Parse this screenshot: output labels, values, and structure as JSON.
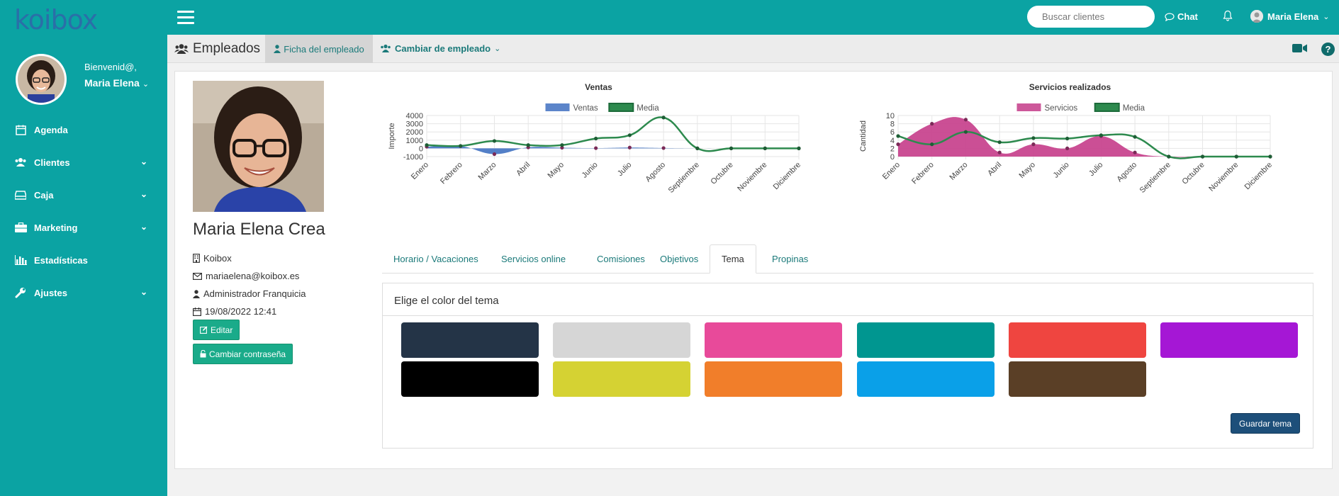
{
  "app": {
    "logo": "koibox"
  },
  "sidebar": {
    "welcome": "Bienvenid@,",
    "user_name": "Maria Elena",
    "items": [
      {
        "label": "Agenda",
        "icon": "calendar-icon",
        "has_submenu": false
      },
      {
        "label": "Clientes",
        "icon": "users-icon",
        "has_submenu": true
      },
      {
        "label": "Caja",
        "icon": "cash-drawer-icon",
        "has_submenu": true
      },
      {
        "label": "Marketing",
        "icon": "briefcase-icon",
        "has_submenu": true
      },
      {
        "label": "Estadísticas",
        "icon": "bar-chart-icon",
        "has_submenu": false
      },
      {
        "label": "Ajustes",
        "icon": "wrench-icon",
        "has_submenu": true
      }
    ]
  },
  "topbar": {
    "search_placeholder": "Buscar clientes",
    "chat_label": "Chat",
    "user_name": "Maria Elena"
  },
  "subbar": {
    "title": "Empleados",
    "active_tab": "Ficha del empleado",
    "change_label": "Cambiar de empleado"
  },
  "employee": {
    "name": "Maria Elena Crea",
    "company": "Koibox",
    "email": "mariaelena@koibox.es",
    "role": "Administrador Franquicia",
    "date": "19/08/2022 12:41",
    "edit_label": "Editar",
    "change_password_label": "Cambiar contraseña"
  },
  "chart_data": [
    {
      "type": "area",
      "title": "Ventas",
      "ylabel": "Importe",
      "categories": [
        "Enero",
        "Febrero",
        "Marzo",
        "Abril",
        "Mayo",
        "Junio",
        "Julio",
        "Agosto",
        "Septiembre",
        "Octubre",
        "Noviembre",
        "Diciembre"
      ],
      "ylim": [
        -1000,
        4000
      ],
      "yticks": [
        4000,
        3000,
        2000,
        1000,
        0,
        -1000
      ],
      "series": [
        {
          "name": "Ventas",
          "color": "#4a78c4",
          "fill": true,
          "values": [
            200,
            280,
            -700,
            120,
            80,
            30,
            100,
            40,
            0,
            0,
            0,
            0
          ]
        },
        {
          "name": "Media",
          "color": "#2d8a4e",
          "fill": false,
          "values": [
            400,
            300,
            900,
            400,
            400,
            1200,
            1600,
            3750,
            0,
            0,
            0,
            0
          ]
        }
      ],
      "legend": "top"
    },
    {
      "type": "area",
      "title": "Servicios realizados",
      "ylabel": "Cantidad",
      "categories": [
        "Enero",
        "Febrero",
        "Marzo",
        "Abril",
        "Mayo",
        "Junio",
        "Julio",
        "Agosto",
        "Septiembre",
        "Octubre",
        "Noviembre",
        "Diciembre"
      ],
      "ylim": [
        0,
        10
      ],
      "yticks": [
        10,
        8,
        6,
        4,
        2,
        0
      ],
      "series": [
        {
          "name": "Servicios",
          "color": "#c8468f",
          "fill": true,
          "values": [
            3,
            8,
            9,
            1,
            3,
            2,
            5,
            1,
            0,
            0,
            0,
            0
          ]
        },
        {
          "name": "Media",
          "color": "#2d8a4e",
          "fill": false,
          "values": [
            5,
            3,
            6,
            3.5,
            4.5,
            4.4,
            5.2,
            4.8,
            0,
            0,
            0,
            0
          ]
        }
      ],
      "legend": "top"
    }
  ],
  "tabs": [
    {
      "label": "Horario / Vacaciones",
      "active": false
    },
    {
      "label": "Servicios online",
      "active": false
    },
    {
      "label": "Comisiones",
      "active": false
    },
    {
      "label": "Objetivos",
      "active": false
    },
    {
      "label": "Tema",
      "active": true
    },
    {
      "label": "Propinas",
      "active": false
    }
  ],
  "theme": {
    "title": "Elige el color del tema",
    "colors": [
      "#243447",
      "#d6d6d6",
      "#e84a9a",
      "#009690",
      "#ef4540",
      "#a517d5",
      "#000000",
      "#d5d233",
      "#f17e2a",
      "#0aa0e8",
      "#5a3f26"
    ],
    "save_label": "Guardar tema"
  }
}
